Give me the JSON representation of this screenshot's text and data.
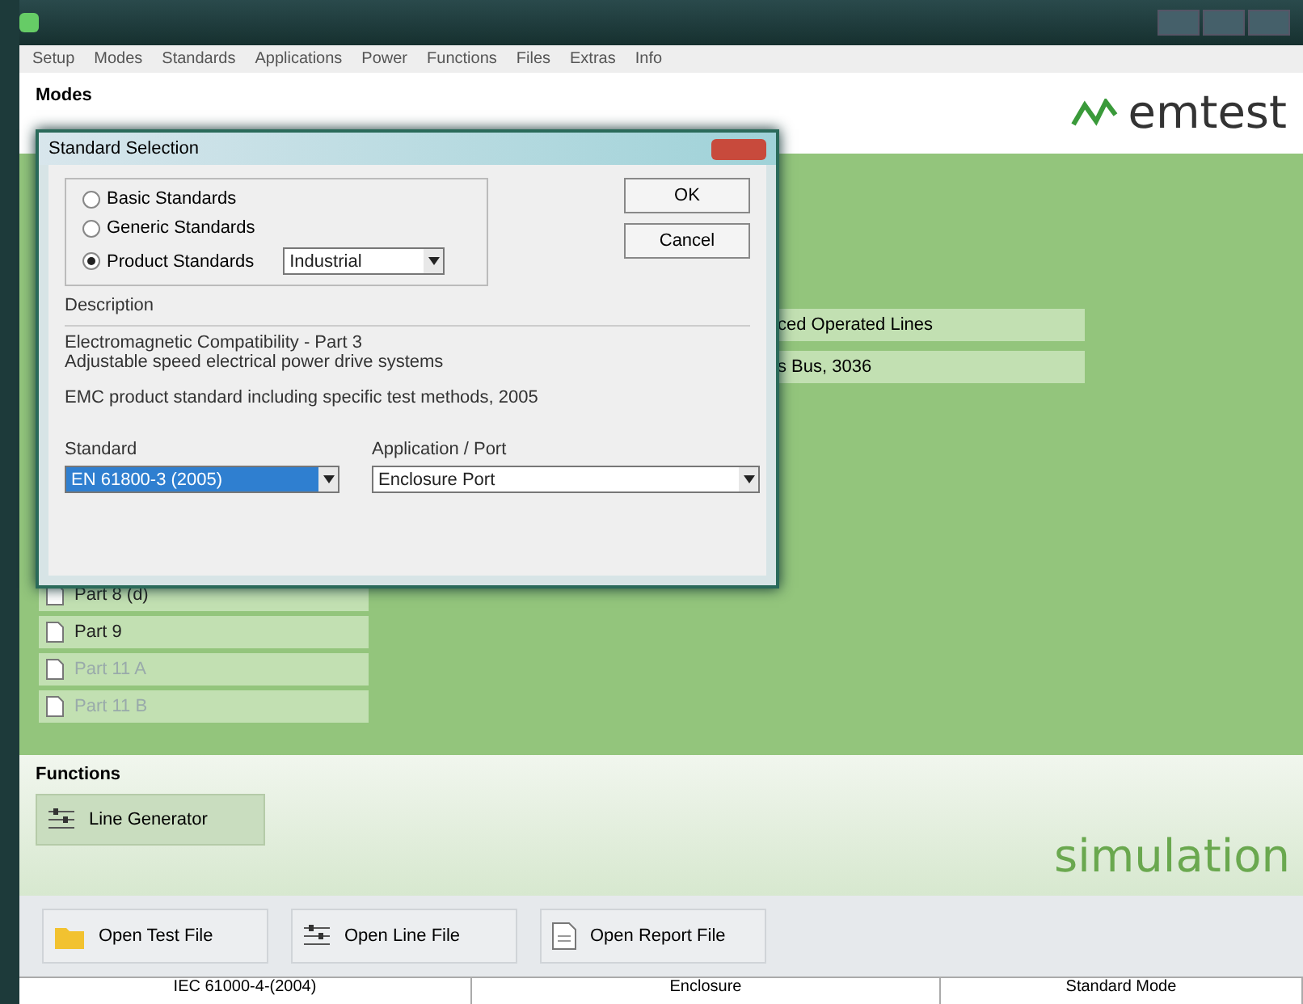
{
  "menu": [
    "Setup",
    "Modes",
    "Standards",
    "Applications",
    "Power",
    "Functions",
    "Files",
    "Extras",
    "Info"
  ],
  "modes": {
    "heading": "Modes",
    "left_items": [
      {
        "label": "Part 8 (d)",
        "disabled": false
      },
      {
        "label": "Part 9",
        "disabled": false
      },
      {
        "label": "Part 11 A",
        "disabled": true
      },
      {
        "label": "Part 11 B",
        "disabled": true
      }
    ],
    "right_items": [
      {
        "label": "ced Operated Lines"
      },
      {
        "label": "s Bus, 3036"
      }
    ]
  },
  "logo": {
    "brand": "emtest"
  },
  "functions": {
    "heading": "Functions",
    "buttons": [
      "Line Generator"
    ],
    "tagline": "simulation"
  },
  "toolbar": [
    "Open Test File",
    "Open Line File",
    "Open Report File"
  ],
  "status_bar": [
    "IEC 61000-4-(2004)",
    "Enclosure",
    "Standard Mode"
  ],
  "dialog": {
    "title": "Standard Selection",
    "options": [
      {
        "label": "Basic Standards",
        "selected": false
      },
      {
        "label": "Generic Standards",
        "selected": false
      },
      {
        "label": "Product Standards",
        "selected": true
      }
    ],
    "category": "Industrial",
    "buttons": [
      "OK",
      "Cancel"
    ],
    "description_label": "Description",
    "description": [
      [
        "Electromagnetic Compatibility - Part 3",
        "Adjustable speed electrical power drive systems"
      ],
      [
        "EMC product standard including specific test methods, 2005"
      ]
    ],
    "standard_label": "Standard",
    "standard": "EN 61800-3 (2005)",
    "port_label": "Application / Port",
    "port": "Enclosure Port"
  }
}
